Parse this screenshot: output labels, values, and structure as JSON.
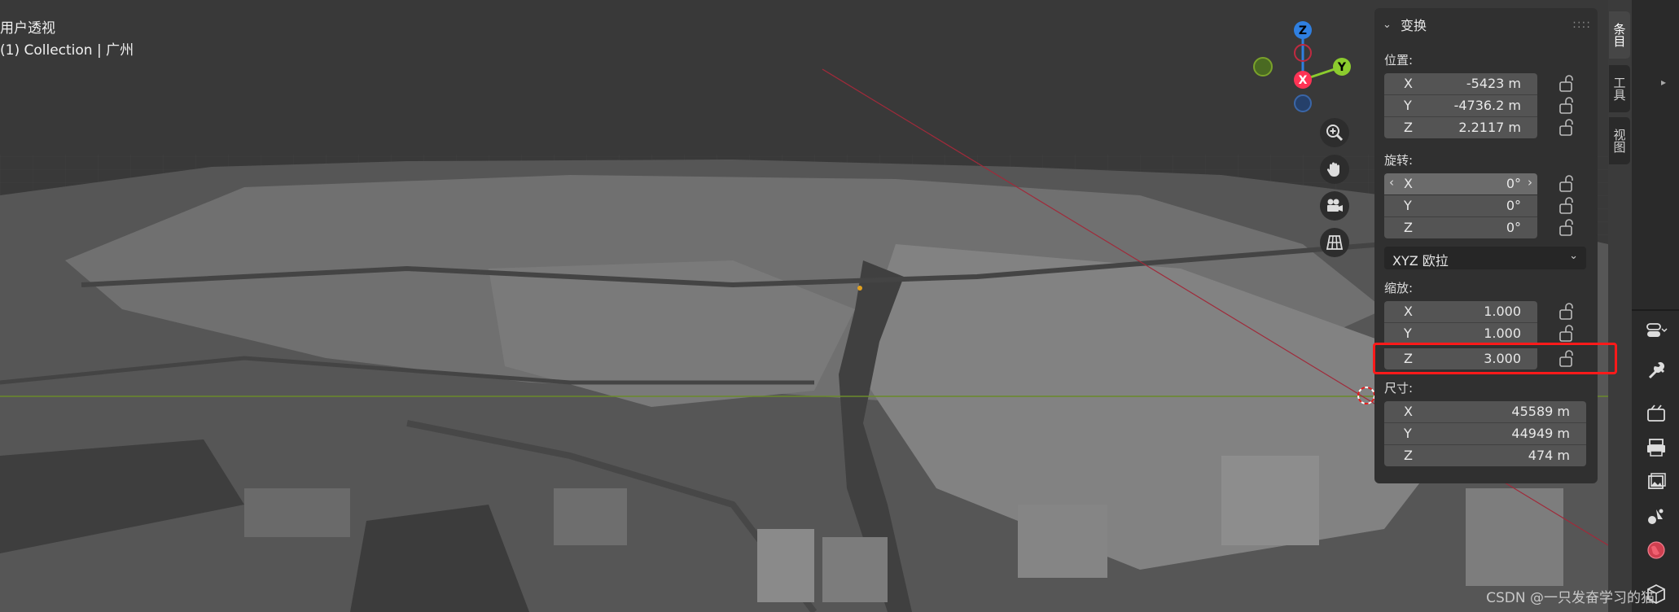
{
  "viewport": {
    "mode_label": "用户透视",
    "collection_label": "(1) Collection | 广州"
  },
  "gizmo": {
    "z": "Z",
    "x": "X",
    "y": "Y"
  },
  "nav": [
    "zoom-icon",
    "hand-icon",
    "camera-icon",
    "grid-icon"
  ],
  "transform": {
    "title": "变换",
    "location": {
      "label": "位置:",
      "x_axis": "X",
      "x": "-5423 m",
      "y_axis": "Y",
      "y": "-4736.2 m",
      "z_axis": "Z",
      "z": "2.2117 m"
    },
    "rotation": {
      "label": "旋转:",
      "x_axis": "X",
      "x": "0°",
      "y_axis": "Y",
      "y": "0°",
      "z_axis": "Z",
      "z": "0°"
    },
    "rotation_mode": "XYZ 欧拉",
    "scale": {
      "label": "缩放:",
      "x_axis": "X",
      "x": "1.000",
      "y_axis": "Y",
      "y": "1.000",
      "z_axis": "Z",
      "z": "3.000"
    },
    "dimensions": {
      "label": "尺寸:",
      "x_axis": "X",
      "x": "45589 m",
      "y_axis": "Y",
      "y": "44949 m",
      "z_axis": "Z",
      "z": "474 m"
    }
  },
  "tabs": [
    "条目",
    "工具",
    "视图"
  ],
  "watermark": "CSDN @一只发奋学习的猫",
  "colors": {
    "highlight": "#ff1a1a",
    "axis_x": "#ff3355",
    "axis_y": "#8ccc2e",
    "axis_z": "#2f7fe0"
  }
}
